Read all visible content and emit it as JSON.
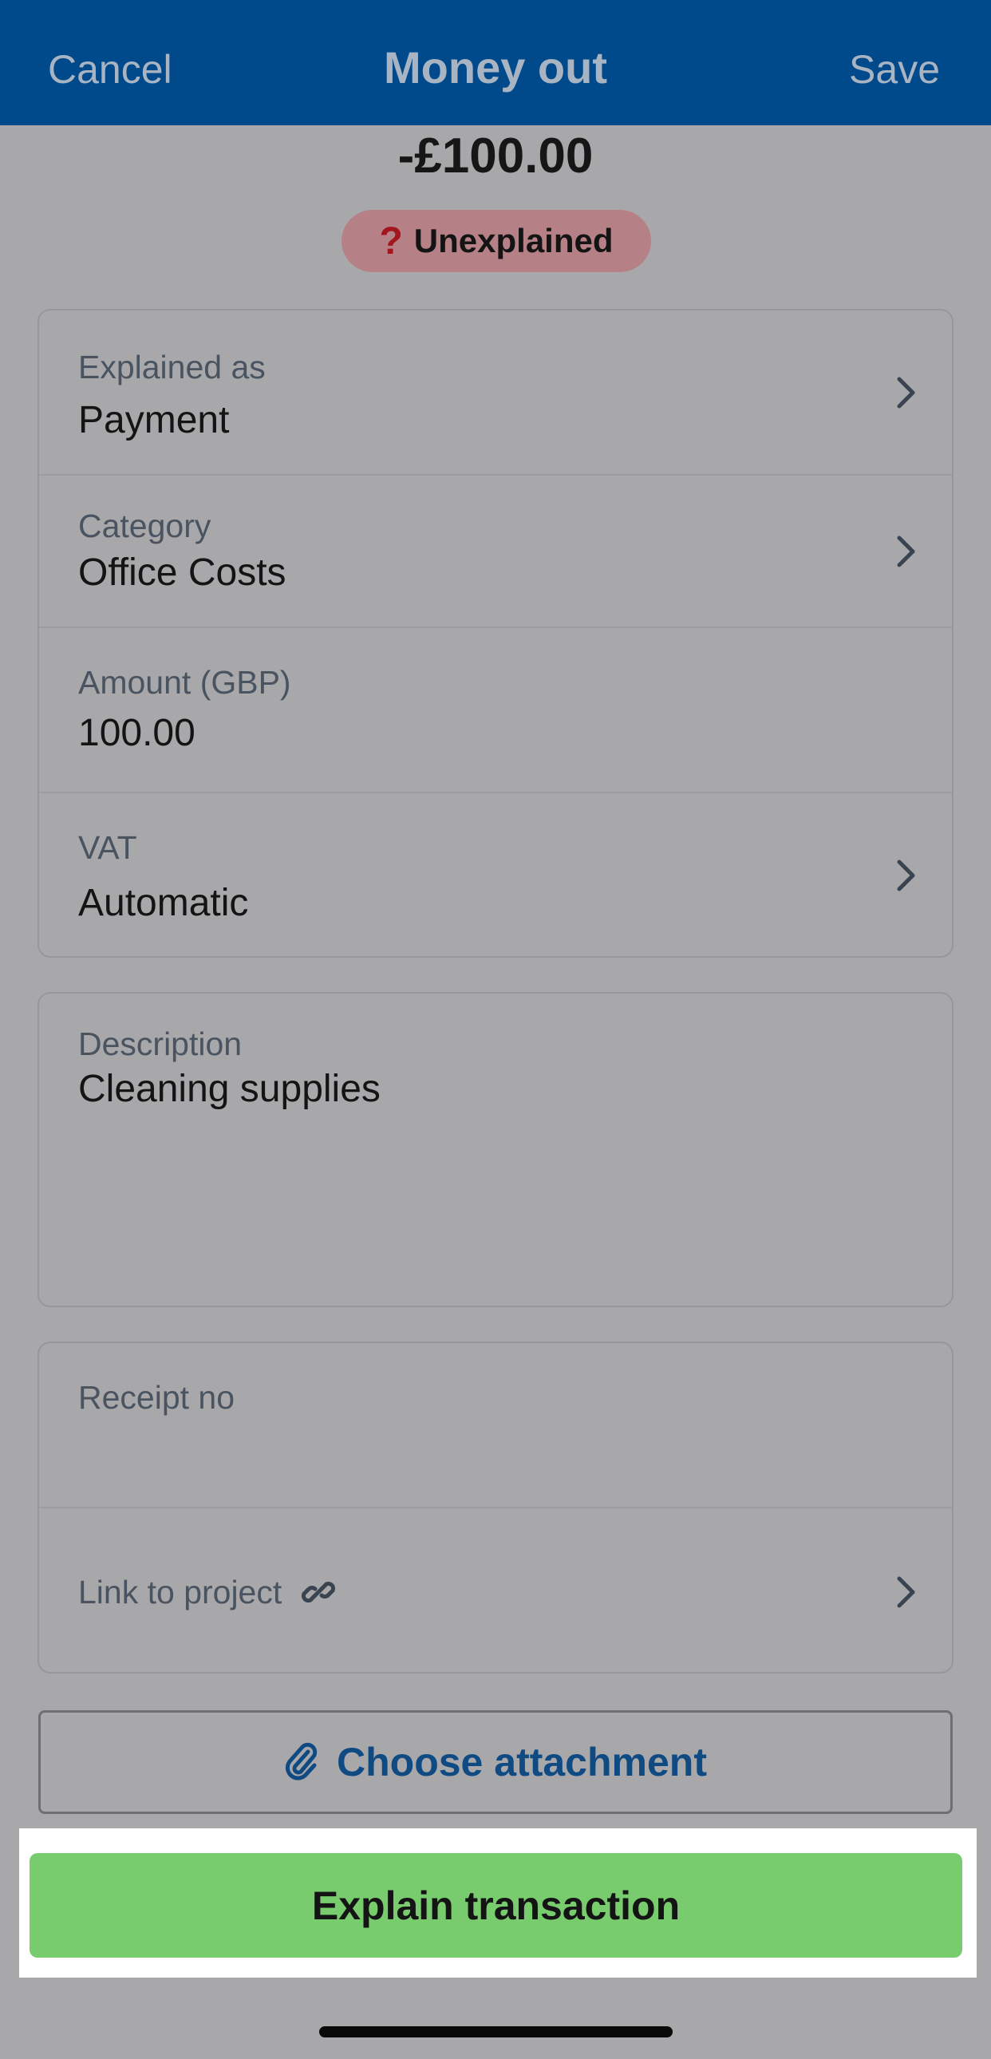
{
  "nav": {
    "cancel": "Cancel",
    "title": "Money out",
    "save": "Save"
  },
  "amount": "-£100.00",
  "status_badge": {
    "icon": "question-icon",
    "label": "Unexplained",
    "color": "#a4161e"
  },
  "details": {
    "explained_as": {
      "label": "Explained as",
      "value": "Payment"
    },
    "category": {
      "label": "Category",
      "value": "Office Costs"
    },
    "amount_gbp": {
      "label": "Amount (GBP)",
      "value": "100.00"
    },
    "vat": {
      "label": "VAT",
      "value": "Automatic"
    }
  },
  "description": {
    "label": "Description",
    "value": "Cleaning supplies"
  },
  "extra": {
    "receipt_no": {
      "label": "Receipt no",
      "value": ""
    },
    "link_to_project": {
      "label": "Link to project",
      "icon": "link-icon"
    }
  },
  "attachment_button": {
    "label": "Choose attachment",
    "icon": "paperclip-icon"
  },
  "explain_button": {
    "label": "Explain transaction"
  },
  "colors": {
    "nav_bg": "#004a8c",
    "accent_green": "#79cc6e",
    "link_blue": "#0f4a83",
    "badge_bg": "#b68186"
  }
}
